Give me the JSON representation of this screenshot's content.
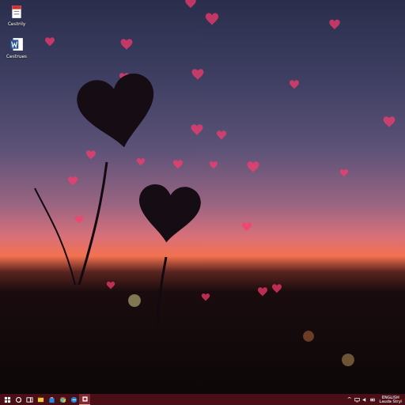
{
  "desktop": {
    "icons": [
      {
        "label": "Cestrily",
        "kind": "document"
      },
      {
        "label": "Cestrues",
        "kind": "word"
      }
    ]
  },
  "taskbar": {
    "apps": [
      {
        "kind": "start",
        "selected": false
      },
      {
        "kind": "search",
        "selected": false
      },
      {
        "kind": "taskview",
        "selected": false
      },
      {
        "kind": "explorer",
        "selected": false
      },
      {
        "kind": "store",
        "selected": false
      },
      {
        "kind": "chrome",
        "selected": false
      },
      {
        "kind": "edge",
        "selected": false
      },
      {
        "kind": "app",
        "selected": true
      }
    ],
    "tray": {
      "caret": "^",
      "line1": "ENGLISH",
      "line2": "Lauda Stryl"
    }
  }
}
